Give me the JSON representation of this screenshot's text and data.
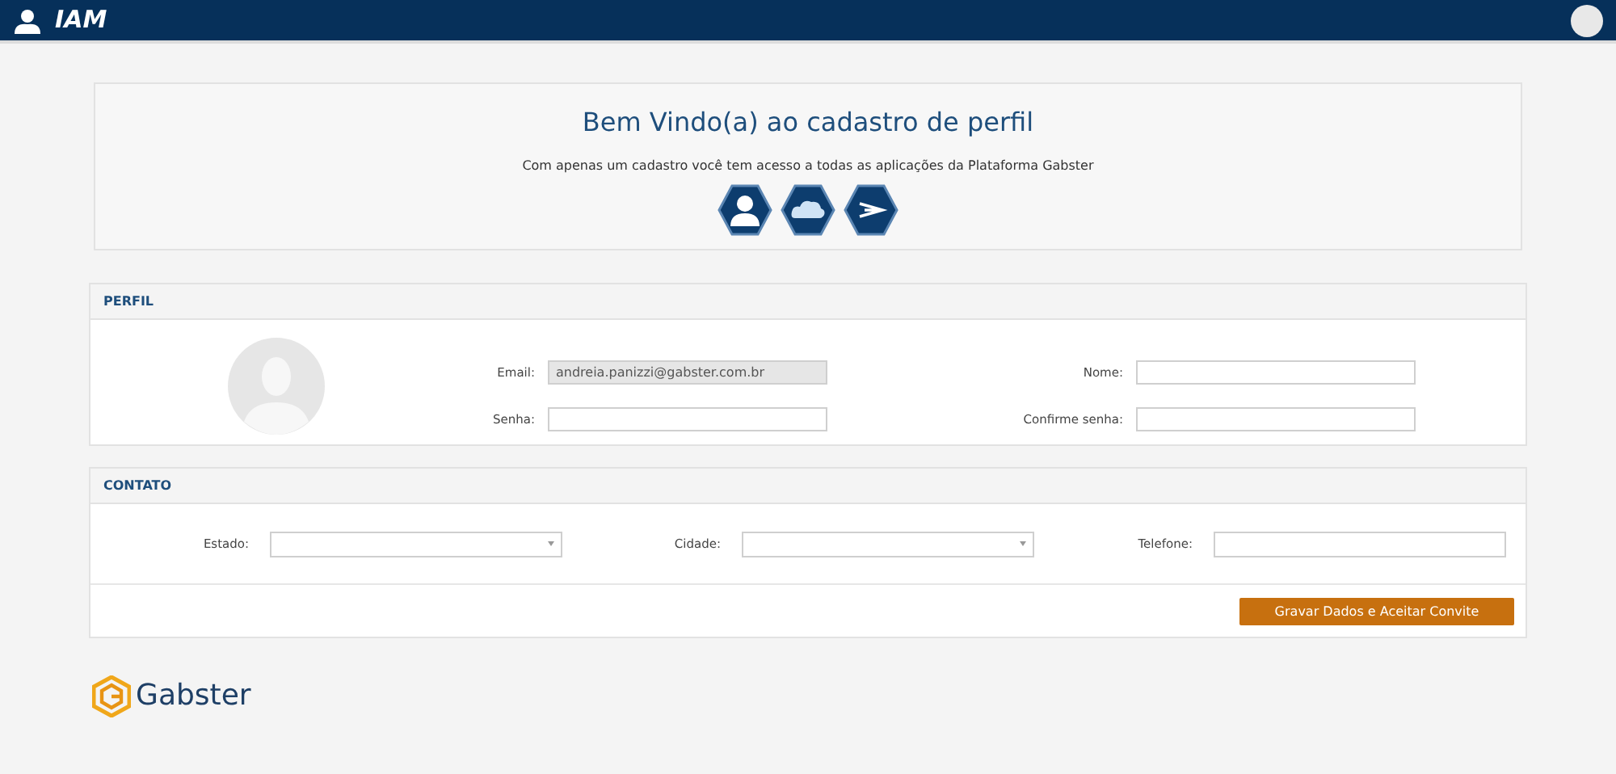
{
  "header": {
    "app_name": "IAM"
  },
  "welcome": {
    "title": "Bem Vindo(a) ao cadastro de perfil",
    "subtitle": "Com apenas um cadastro você tem acesso a todas as aplicações da Plataforma Gabster"
  },
  "perfil": {
    "title": "PERFIL",
    "fields": [
      {
        "label": "Email:",
        "value": "andreia.panizzi@gabster.com.br",
        "disabled": true
      },
      {
        "label": "Nome:",
        "disabled": false
      },
      {
        "label": "Senha:",
        "disabled": false
      },
      {
        "label": "Confirme senha:",
        "disabled": false
      }
    ]
  },
  "contato": {
    "title": "CONTATO",
    "fields": [
      {
        "label": "Estado:",
        "kind": "select"
      },
      {
        "label": "Cidade:",
        "kind": "select"
      },
      {
        "label": "Telefone:",
        "kind": "text"
      }
    ]
  },
  "submit_button": "Gravar Dados e Aceitar Convite",
  "footer": {
    "logo_text": "Gabster"
  }
}
